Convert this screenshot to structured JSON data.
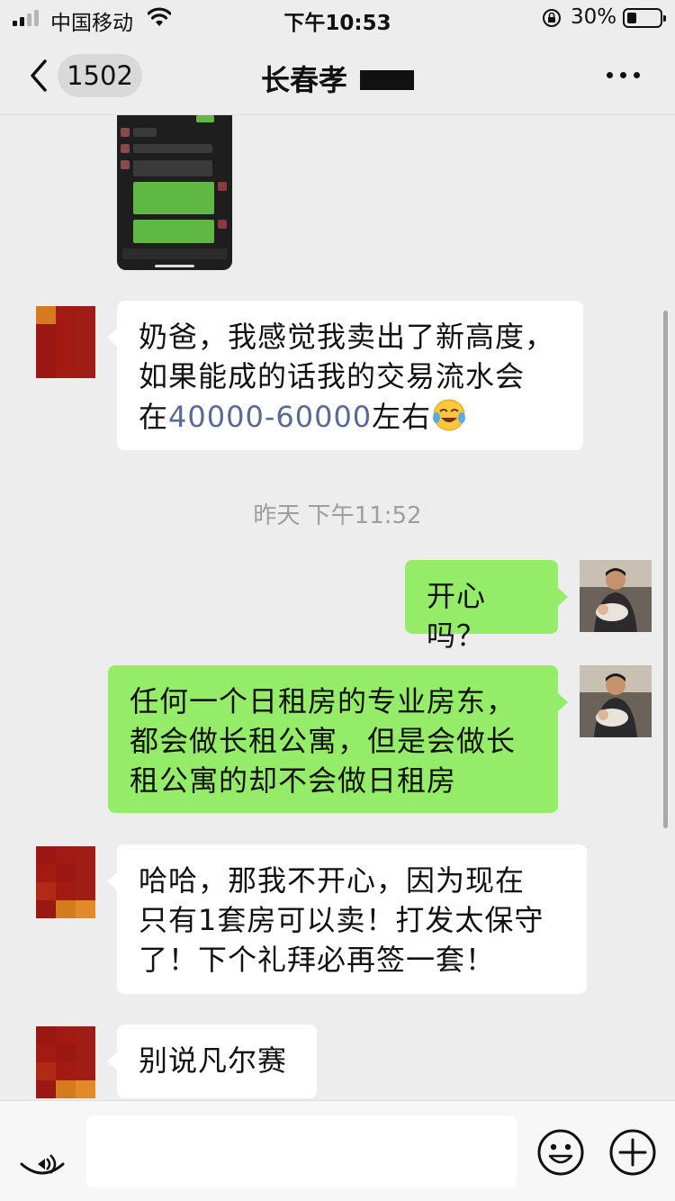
{
  "status_bar": {
    "carrier": "中国移动",
    "time": "下午10:53",
    "battery": "30%",
    "battery_level": 0.3
  },
  "nav": {
    "back_count": "1502",
    "title": "长春孝"
  },
  "messages": [
    {
      "side": "left",
      "parts": {
        "line1": "奶爸，我感觉我卖出了新高度，",
        "line2": "如果能成的话我的交易流水会",
        "line3a": "在",
        "link": "40000-60000",
        "line3b": "左右"
      }
    },
    {
      "side": "right",
      "text_lines": [
        "开心吗？"
      ]
    },
    {
      "side": "right",
      "text_lines": [
        "任何一个日租房的专业房东，",
        "都会做长租公寓，但是会做长",
        "租公寓的却不会做日租房"
      ]
    },
    {
      "side": "left",
      "text_lines": [
        "哈哈，那我不开心，因为现在",
        "只有1套房可以卖！打发太保守",
        "了！下个礼拜必再签一套！"
      ]
    },
    {
      "side": "left",
      "text_lines": [
        "别说凡尔赛"
      ]
    }
  ],
  "timestamp": "昨天 下午11:52",
  "input_bar": {
    "left_icon": "voice-icon",
    "right_icons": [
      "emoji-icon",
      "plus-icon"
    ]
  },
  "colors": {
    "background": "#ededed",
    "green_bubble": "#95ec69",
    "white_bubble": "#ffffff",
    "link": "#576b95"
  }
}
